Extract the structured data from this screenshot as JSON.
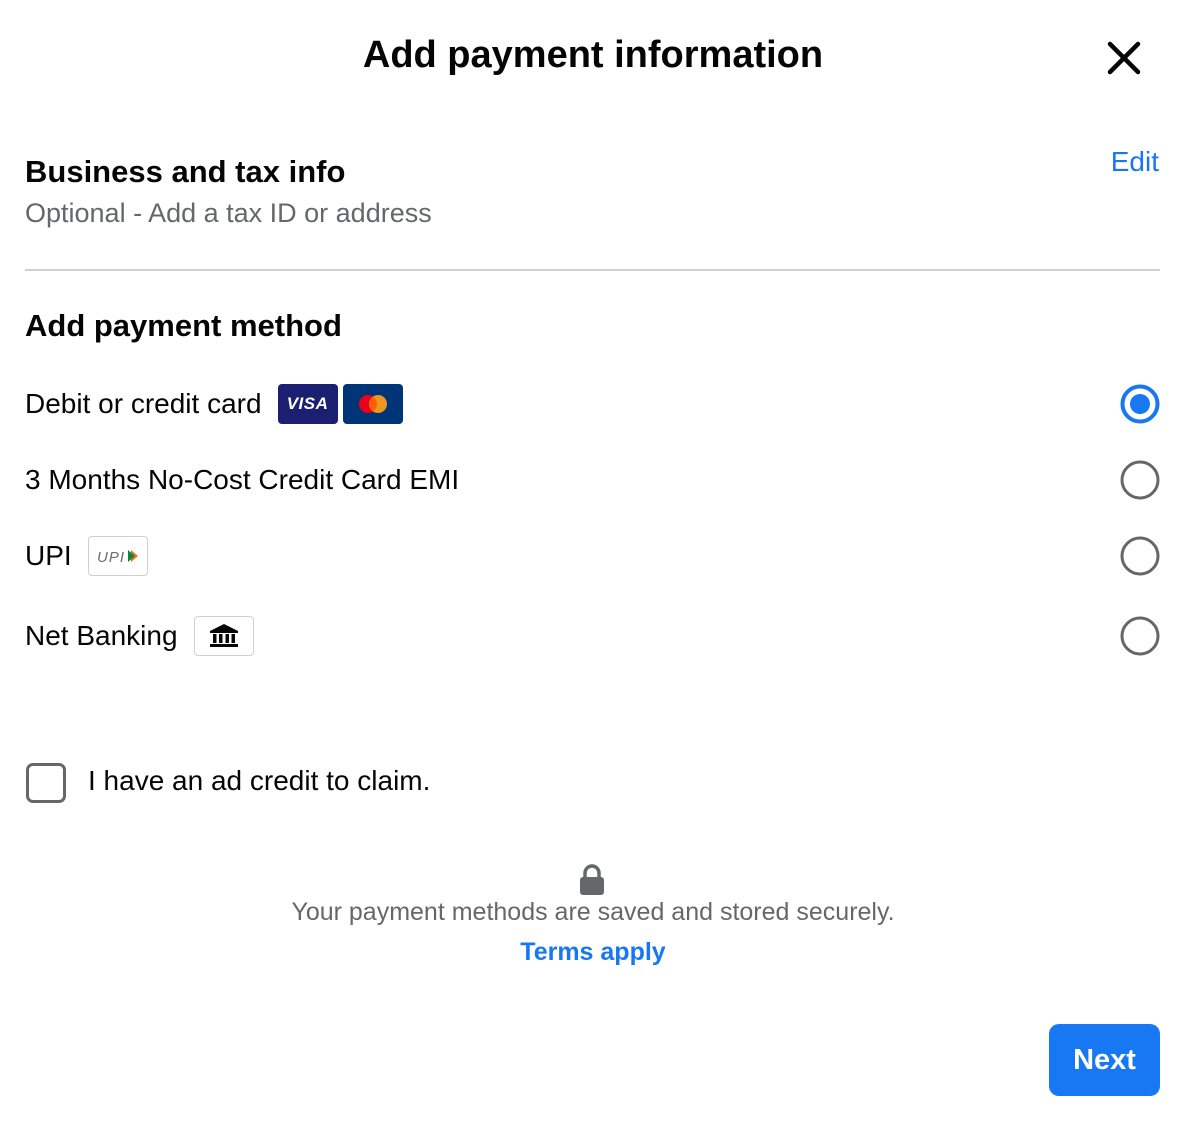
{
  "dialog": {
    "title": "Add payment information",
    "close_icon": "close-icon"
  },
  "business": {
    "title": "Business and tax info",
    "subtitle": "Optional - Add a tax ID or address",
    "edit_label": "Edit"
  },
  "payment": {
    "title": "Add payment method",
    "selected_index": 0,
    "options": [
      {
        "label": "Debit or credit card",
        "icons": [
          "visa-logo",
          "mastercard-logo"
        ],
        "selected": true
      },
      {
        "label": "3 Months No-Cost Credit Card EMI",
        "icons": [],
        "selected": false
      },
      {
        "label": "UPI",
        "icons": [
          "upi-logo"
        ],
        "selected": false
      },
      {
        "label": "Net Banking",
        "icons": [
          "bank-icon"
        ],
        "selected": false
      }
    ],
    "visa_text": "VISA",
    "upi_text": "UPI"
  },
  "ad_credit": {
    "label": "I have an ad credit to claim.",
    "checked": false
  },
  "security": {
    "icon": "lock-icon",
    "text": "Your payment methods are saved and stored securely.",
    "terms_label": "Terms apply"
  },
  "footer": {
    "next_label": "Next"
  },
  "colors": {
    "accent": "#1877f2",
    "secondary_text": "#65676b",
    "visa_bg": "#1a1f71",
    "mastercard_bg": "#003478"
  }
}
